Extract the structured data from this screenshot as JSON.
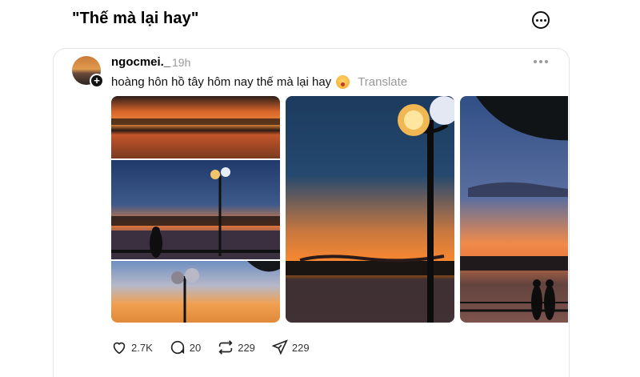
{
  "header": {
    "title": "\"Thế mà lại hay\""
  },
  "post": {
    "username": "ngocmei._",
    "time": "19h",
    "caption": "hoàng hôn hồ tây hôm nay thế mà lại hay",
    "caption_emoji": "flushed-face-emoji",
    "translate_label": "Translate",
    "photos": [
      {
        "description": "sunset-collage"
      },
      {
        "description": "street-lamp-sunset"
      },
      {
        "description": "silhouettes-by-lake"
      }
    ],
    "stats": {
      "likes": "2.7K",
      "comments": "20",
      "reposts": "229",
      "shares": "229"
    }
  },
  "icons": {
    "title_more": "more-circle-icon",
    "post_more": "more-horizontal-icon",
    "like": "heart-icon",
    "comment": "comment-icon",
    "repost": "repost-icon",
    "share": "send-icon"
  }
}
